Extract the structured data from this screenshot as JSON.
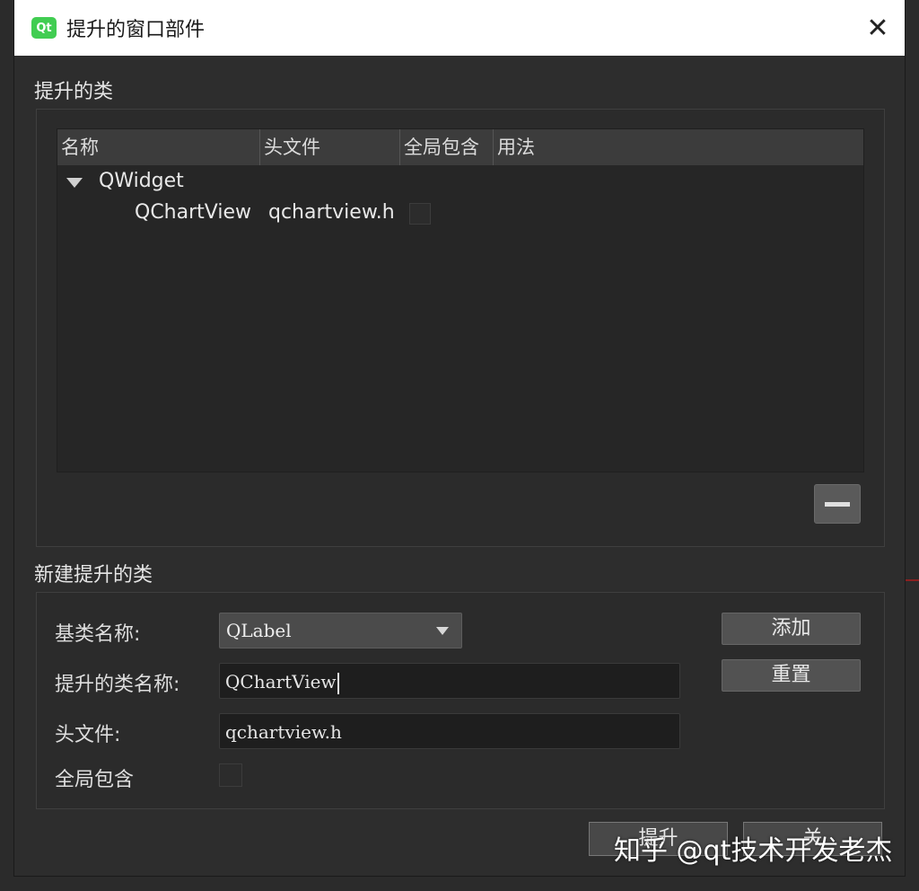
{
  "window": {
    "title": "提升的窗口部件",
    "app_icon": "Qt",
    "close_glyph": "✕"
  },
  "promoted_section": {
    "title": "提升的类",
    "columns": [
      "名称",
      "头文件",
      "全局包含",
      "用法"
    ],
    "tree": {
      "parent": "QWidget",
      "children": [
        {
          "name": "QChartView",
          "header": "qchartview.h",
          "global_include": false
        }
      ]
    }
  },
  "new_section": {
    "title": "新建提升的类",
    "base_class_label": "基类名称:",
    "base_class_value": "QLabel",
    "promoted_name_label": "提升的类名称:",
    "promoted_name_value": "QChartView",
    "header_label": "头文件:",
    "header_value": "qchartview.h",
    "global_include_label": "全局包含",
    "add_button": "添加",
    "reset_button": "重置"
  },
  "footer": {
    "promote_button": "提升",
    "close_button": "关"
  },
  "watermark": "知乎 @qt技术开发老杰",
  "colors": {
    "background": "#2d2d2d",
    "titlebar": "#ffffff",
    "qt_green": "#41cd52"
  }
}
